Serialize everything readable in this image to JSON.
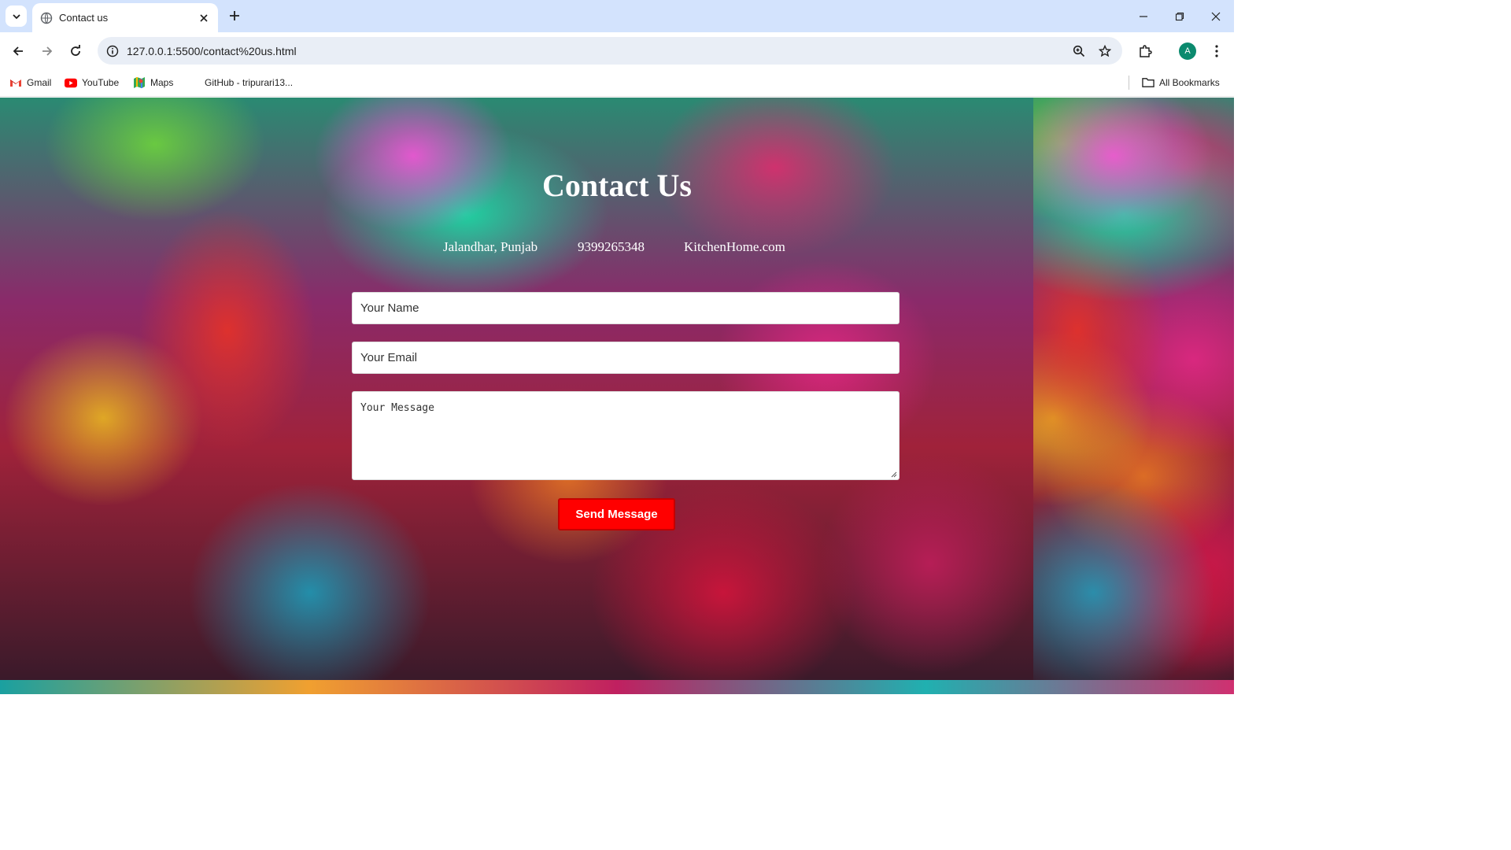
{
  "browser": {
    "tab": {
      "title": "Contact us"
    },
    "url": "127.0.0.1:5500/contact%20us.html",
    "profile_initial": "A",
    "bookmarks": [
      {
        "label": "Gmail",
        "icon": "gmail-icon"
      },
      {
        "label": "YouTube",
        "icon": "youtube-icon"
      },
      {
        "label": "Maps",
        "icon": "maps-icon"
      },
      {
        "label": "GitHub - tripurari13...",
        "icon": ""
      }
    ],
    "all_bookmarks_label": "All Bookmarks"
  },
  "page": {
    "title": "Contact Us",
    "info": {
      "location": "Jalandhar, Punjab",
      "phone": "9399265348",
      "website": "KitchenHome.com"
    },
    "form": {
      "name_placeholder": "Your Name",
      "email_placeholder": "Your Email",
      "message_placeholder": "Your Message",
      "submit_label": "Send Message"
    },
    "colors": {
      "submit_bg": "#ff0000",
      "chrome_bg": "#d3e3fd"
    }
  }
}
